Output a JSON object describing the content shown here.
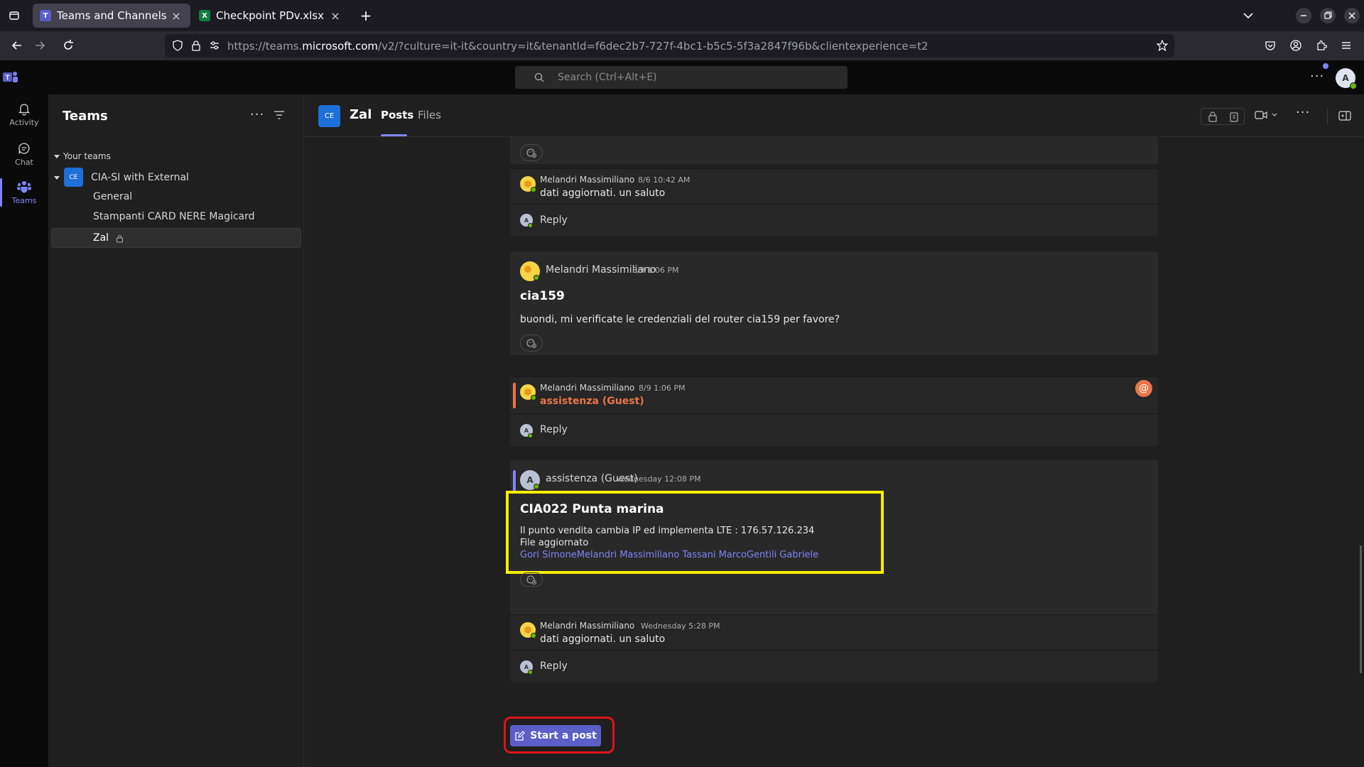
{
  "browser": {
    "tabs": [
      {
        "title": "Teams and Channels | Zal",
        "icon": "teams-icon",
        "active": true
      },
      {
        "title": "Checkpoint PDv.xlsx",
        "icon": "excel-icon",
        "active": false
      }
    ],
    "url_prefix": "https://teams.",
    "url_domain": "microsoft.com",
    "url_rest": "/v2/?culture=it-it&country=it&tenantId=f6dec2b7-727f-4bc1-b5c5-5f3a2847f96b&clientexperience=t2"
  },
  "teams": {
    "search_placeholder": "Search (Ctrl+Alt+E)",
    "user_initial": "A",
    "rail": [
      {
        "label": "Activity",
        "icon": "bell-icon"
      },
      {
        "label": "Chat",
        "icon": "chat-icon"
      },
      {
        "label": "Teams",
        "icon": "teams-icon",
        "active": true
      }
    ],
    "panel": {
      "title": "Teams",
      "section": "Your teams",
      "team": {
        "initials": "CE",
        "name": "CIA-SI with External"
      },
      "channels": [
        "General",
        "Stampanti CARD NERE Magicard",
        "Zal"
      ]
    },
    "channel": {
      "initials": "CE",
      "name": "Zal",
      "tabs": [
        "Posts",
        "Files"
      ]
    },
    "feed": {
      "reply_label": "Reply",
      "reply1": {
        "author": "Melandri Massimiliano",
        "time": "8/6 10:42 AM",
        "text": "dati aggiornati. un saluto"
      },
      "post2": {
        "author": "Melandri Massimiliano",
        "time": "8/9 1:06 PM",
        "subject": "cia159",
        "body": "buondi, mi verificate le credenziali del router cia159 per favore?",
        "reply": {
          "author": "Melandri Massimiliano",
          "time": "8/9 1:06 PM",
          "mention": "assistenza (Guest)"
        }
      },
      "post3": {
        "author": "assistenza (Guest)",
        "time": "Wednesday 12:08 PM",
        "author_initial": "A",
        "subject": "CIA022 Punta marina",
        "line1": "Il punto vendita cambia IP ed implementa LTE : 176.57.126.234",
        "line2": "File aggiornato",
        "mentions": "Gori SimoneMelandri Massimiliano Tassani MarcoGentili Gabriele",
        "reply": {
          "author": "Melandri Massimiliano",
          "time": "Wednesday 5:28 PM",
          "text": "dati aggiornati. un saluto"
        }
      },
      "start_post_label": "Start a post"
    },
    "colors": {
      "accent": "#5b5fc7",
      "highlight_box": "#f5ee00",
      "cta_outline": "#e0121b",
      "mention": "#e97548"
    }
  }
}
